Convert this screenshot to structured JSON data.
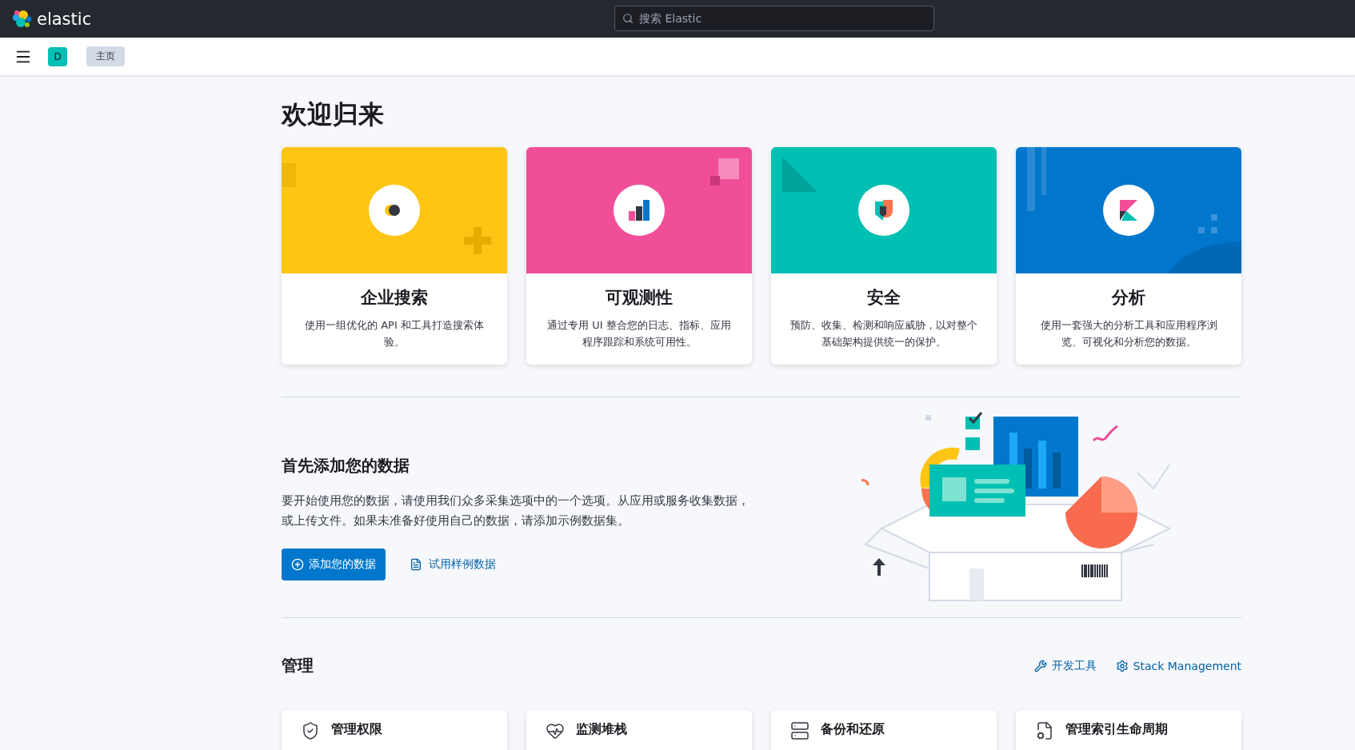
{
  "header": {
    "logo": "elastic",
    "search": {
      "placeholder": "搜索 Elastic"
    }
  },
  "navbar": {
    "avatar": "D",
    "breadcrumb": "主页"
  },
  "title": "欢迎归来",
  "solutions": [
    {
      "kind": "search",
      "title": "企业搜索",
      "description": "使用一组优化的 API 和工具打造搜索体验。",
      "color": "#fec514"
    },
    {
      "kind": "observability",
      "title": "可观测性",
      "description": "通过专用 UI 整合您的日志、指标、应用程序跟踪和系统可用性。",
      "color": "#f04e98"
    },
    {
      "kind": "security",
      "title": "安全",
      "description": "预防、收集、检测和响应威胁，以对整个基础架构提供统一的保护。",
      "color": "#00bfb3"
    },
    {
      "kind": "analytics",
      "title": "分析",
      "description": "使用一套强大的分析工具和应用程序浏览、可视化和分析您的数据。",
      "color": "#0077cc"
    }
  ],
  "data_section": {
    "title": "首先添加您的数据",
    "text": "要开始使用您的数据，请使用我们众多采集选项中的一个选项。从应用或服务收集数据，或上传文件。如果未准备好使用自己的数据，请添加示例数据集。",
    "buttons": [
      {
        "kind": "primary",
        "label": "添加您的数据"
      },
      {
        "kind": "link",
        "label": "试用样例数据"
      }
    ]
  },
  "management": {
    "title": "管理",
    "links": [
      {
        "kind": "devtools",
        "label": "开发工具"
      },
      {
        "kind": "settings",
        "label": "Stack Management"
      }
    ],
    "cards": [
      {
        "kind": "shield",
        "title": "管理权限"
      },
      {
        "kind": "heart",
        "title": "监测堆栈"
      },
      {
        "kind": "server",
        "title": "备份和还原"
      },
      {
        "kind": "document",
        "title": "管理索引生命周期"
      }
    ]
  }
}
